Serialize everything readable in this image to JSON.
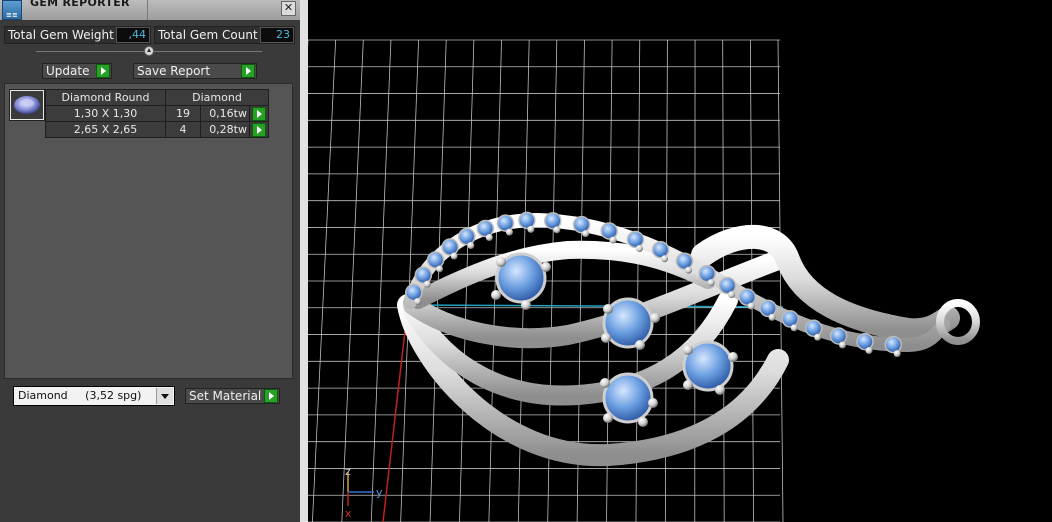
{
  "window": {
    "title": "GEM REPORTER",
    "icon": "gem-reporter-app-icon",
    "close_icon": "close-icon"
  },
  "summary": {
    "weight_label": "Total Gem Weight",
    "weight_value": ",44",
    "count_label": "Total Gem Count",
    "count_value": "23"
  },
  "toolbar": {
    "update_label": "Update",
    "save_report_label": "Save Report",
    "play_icon": "play-icon"
  },
  "gem_group": {
    "thumbnail_icon": "round-diamond-icon",
    "header_cut": "Diamond Round",
    "header_material": "Diamond",
    "rows": [
      {
        "size": "1,30 X 1,30",
        "count": "19",
        "weight": "0,16tw"
      },
      {
        "size": "2,65 X 2,65",
        "count": "4",
        "weight": "0,28tw"
      }
    ]
  },
  "material": {
    "selected": "Diamond",
    "density": "(3,52 spg)",
    "set_label": "Set Material"
  },
  "viewport": {
    "axis_labels": {
      "z": "z",
      "y": "y",
      "x": "x"
    },
    "colors": {
      "grid": "#bfbfbf",
      "metal": "#dedede",
      "gem": "#6a9ee0",
      "x_axis": "#c02020",
      "y_axis": "#20a0c0"
    }
  }
}
